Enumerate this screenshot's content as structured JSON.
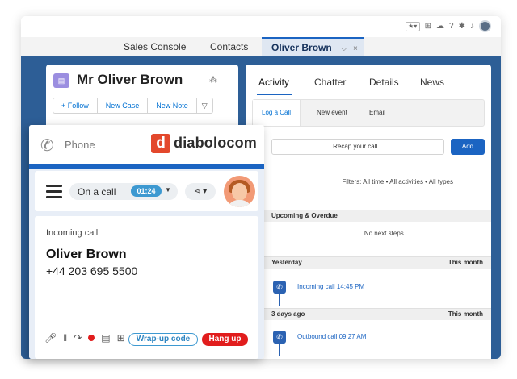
{
  "topbar": {
    "icons": [
      "star-icon",
      "plus-icon",
      "cloud-icon",
      "help-icon",
      "gear-icon",
      "bell-icon",
      "user-avatar"
    ]
  },
  "tabs": {
    "items": [
      {
        "label": "Sales Console"
      },
      {
        "label": "Contacts"
      },
      {
        "label": "Oliver Brown",
        "active": true
      }
    ],
    "chevron": "⌵",
    "close": "×"
  },
  "record": {
    "name": "Mr Oliver Brown",
    "buttons": {
      "follow": "+ Follow",
      "new_case": "New Case",
      "new_note": "New Note",
      "more": "▽"
    }
  },
  "right_panel": {
    "tabs": [
      "Activity",
      "Chatter",
      "Details",
      "News"
    ],
    "subtabs": [
      "Log a Call",
      "New event",
      "Email"
    ],
    "recap_placeholder": "Recap your call...",
    "add_label": "Add",
    "filters": "Filters: All time • All activities • All types",
    "sections": {
      "upcoming": "Upcoming & Overdue",
      "no_next": "No next steps.",
      "yesterday": "Yesterday",
      "yesterday_right": "This month",
      "three_days": "3 days ago",
      "three_days_right": "This month"
    },
    "activities": [
      {
        "text": "Incoming call 14:45 PM"
      },
      {
        "text": "Outbound call 09:27 AM"
      }
    ]
  },
  "phone": {
    "label": "Phone",
    "logo_letter": "d",
    "logo_text": "diabolocom",
    "status": "On a call",
    "timer": "01:24",
    "incoming_label": "Incoming call",
    "caller_name": "Oliver Brown",
    "caller_number": "+44 203 695 5500",
    "wrap_up": "Wrap-up code",
    "hang_up": "Hang up"
  },
  "colors": {
    "brand_blue": "#1b64c2",
    "console_bg": "#2d5e96",
    "hangup_red": "#e11d1d",
    "timer_blue": "#3d99d1",
    "logo_red": "#e3482c"
  }
}
